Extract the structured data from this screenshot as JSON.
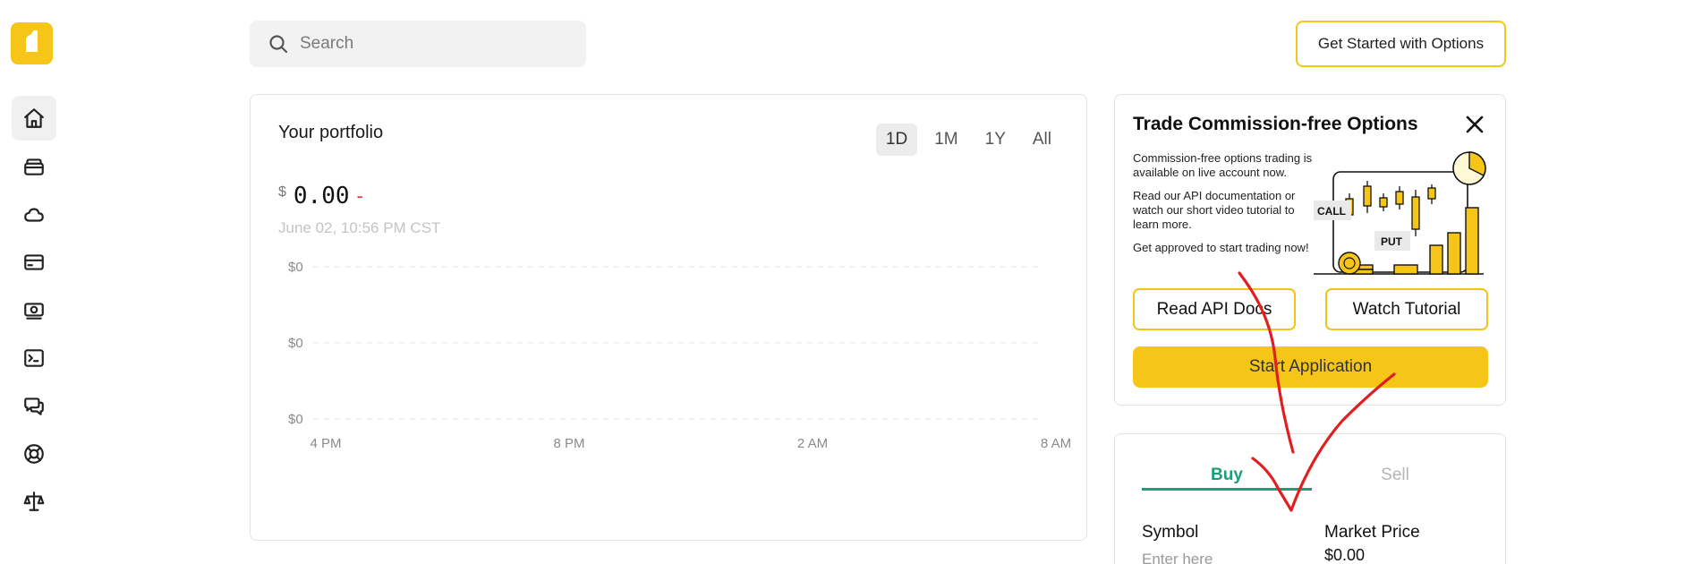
{
  "search": {
    "placeholder": "Search"
  },
  "header": {
    "cta_label": "Get Started with Options"
  },
  "sidebar": {
    "items": [
      {
        "icon": "home-icon"
      },
      {
        "icon": "wallet-icon"
      },
      {
        "icon": "cloud-icon"
      },
      {
        "icon": "card-icon"
      },
      {
        "icon": "cash-icon"
      },
      {
        "icon": "terminal-icon"
      },
      {
        "icon": "chat-icon"
      },
      {
        "icon": "support-icon"
      },
      {
        "icon": "scale-icon"
      }
    ]
  },
  "portfolio": {
    "title": "Your portfolio",
    "ranges": [
      "1D",
      "1M",
      "1Y",
      "All"
    ],
    "active_range": "1D",
    "currency": "$",
    "amount": "0.00",
    "change": "-",
    "timestamp": "June 02, 10:56 PM CST"
  },
  "chart_data": {
    "type": "line",
    "title": "",
    "xlabel": "",
    "ylabel": "",
    "x": [
      "4 PM",
      "8 PM",
      "2 AM",
      "8 AM"
    ],
    "y_tick_labels": [
      "$0",
      "$0",
      "$0"
    ],
    "series": [],
    "grid": true,
    "colors": {
      "grid": "#e6e6e6",
      "axis_text": "#8a8a8a"
    }
  },
  "promo": {
    "title": "Trade Commission-free Options",
    "para1": "Commission-free options trading is available on live account now.",
    "para2": "Read our API documentation or watch our short video tutorial to learn more.",
    "para3": "Get approved to start trading now!",
    "art_call": "CALL",
    "art_put": "PUT",
    "read_docs_label": "Read API Docs",
    "watch_label": "Watch Tutorial",
    "start_label": "Start Application"
  },
  "trade": {
    "buy_label": "Buy",
    "sell_label": "Sell",
    "symbol_label": "Symbol",
    "symbol_placeholder": "Enter here",
    "market_price_label": "Market Price",
    "market_price_value": "$0.00"
  },
  "colors": {
    "brand_yellow": "#f5c518",
    "buy_green": "#1e9e78",
    "negative_red": "#e53935",
    "annotation_red": "#e02020"
  }
}
